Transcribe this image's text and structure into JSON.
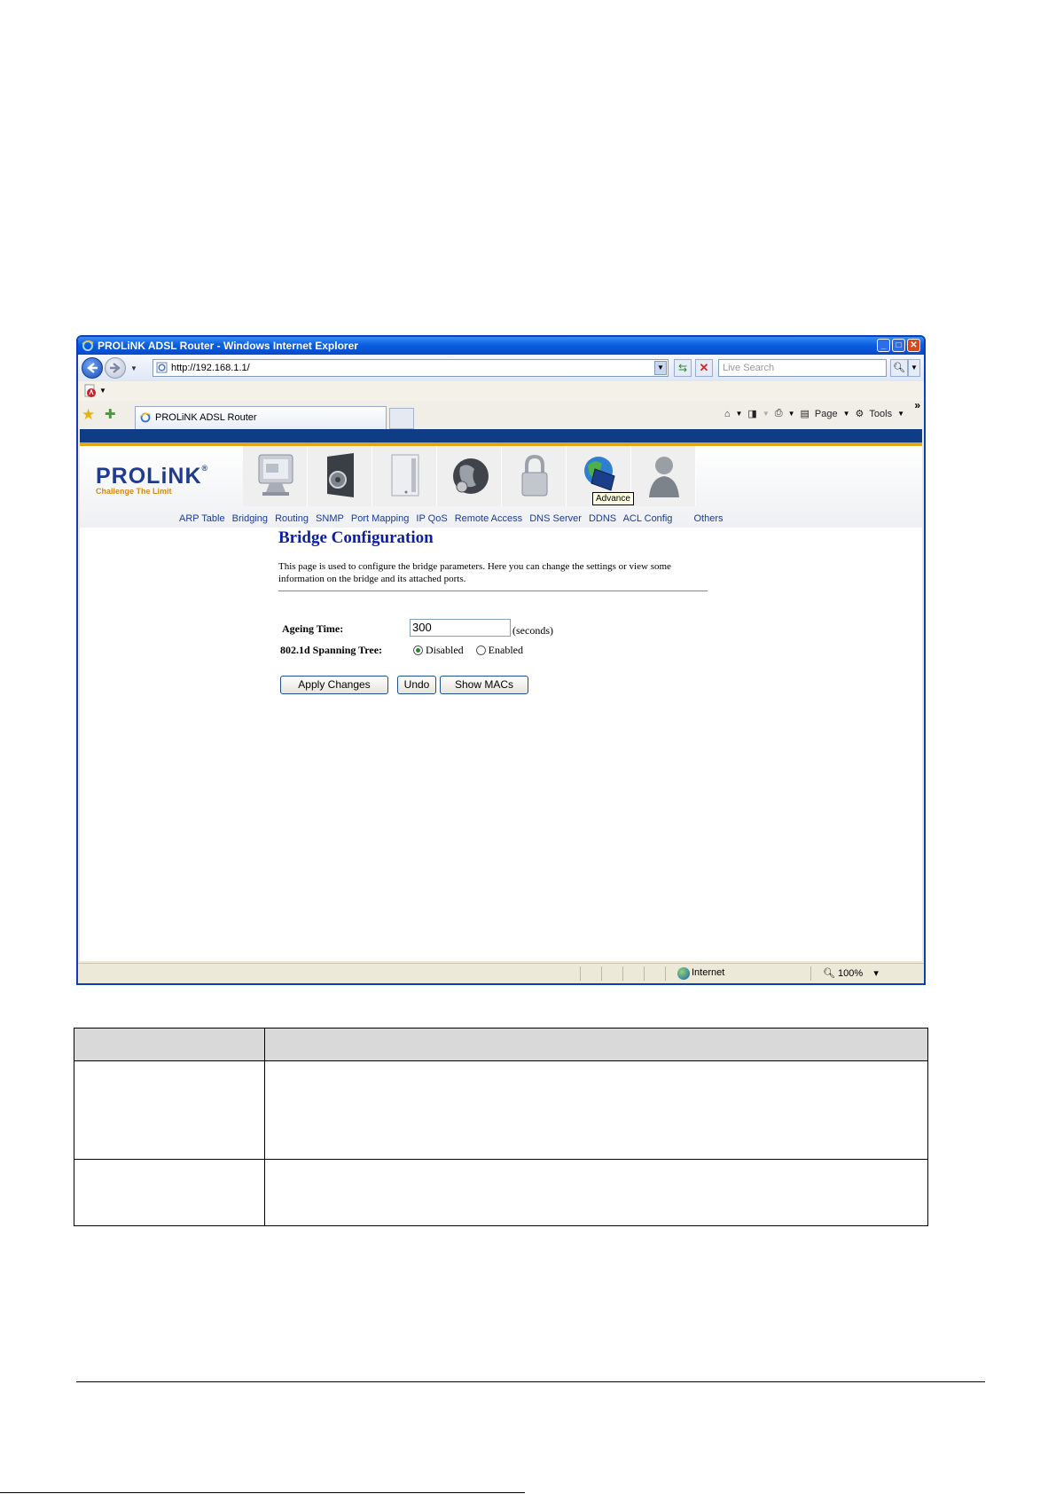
{
  "window": {
    "title": "PROLiNK ADSL Router - Windows Internet Explorer",
    "controls": [
      "minimize",
      "maximize",
      "close"
    ]
  },
  "address_bar": {
    "url": "http://192.168.1.1/",
    "search_placeholder": "Live Search"
  },
  "tabs": {
    "active_label": "PROLiNK ADSL Router"
  },
  "command_bar": {
    "page_label": "Page",
    "tools_label": "Tools"
  },
  "router": {
    "logo_text": "PROLiNK",
    "logo_tagline": "Challenge The Limit",
    "top_icons": [
      "status-monitor",
      "setup-gear",
      "device",
      "network-globe",
      "security-lock",
      "advance-globe",
      "admin-user"
    ],
    "tooltip": "Advance",
    "submenu": [
      "ARP Table",
      "Bridging",
      "Routing",
      "SNMP",
      "Port Mapping",
      "IP QoS",
      "Remote Access",
      "DNS Server",
      "DDNS",
      "ACL Config",
      "Others"
    ],
    "page_title": "Bridge Configuration",
    "description": "This page is used to configure the bridge parameters. Here you can change the settings or view some information on the bridge and its attached ports.",
    "ageing_label": "Ageing Time:",
    "ageing_value": "300",
    "ageing_unit": "(seconds)",
    "spanning_label": "802.1d Spanning Tree:",
    "spanning_options": [
      "Disabled",
      "Enabled"
    ],
    "spanning_selected": "Disabled",
    "buttons": {
      "apply": "Apply Changes",
      "undo": "Undo",
      "show_macs": "Show MACs"
    }
  },
  "status_bar": {
    "zone": "Internet",
    "zoom": "100%"
  }
}
